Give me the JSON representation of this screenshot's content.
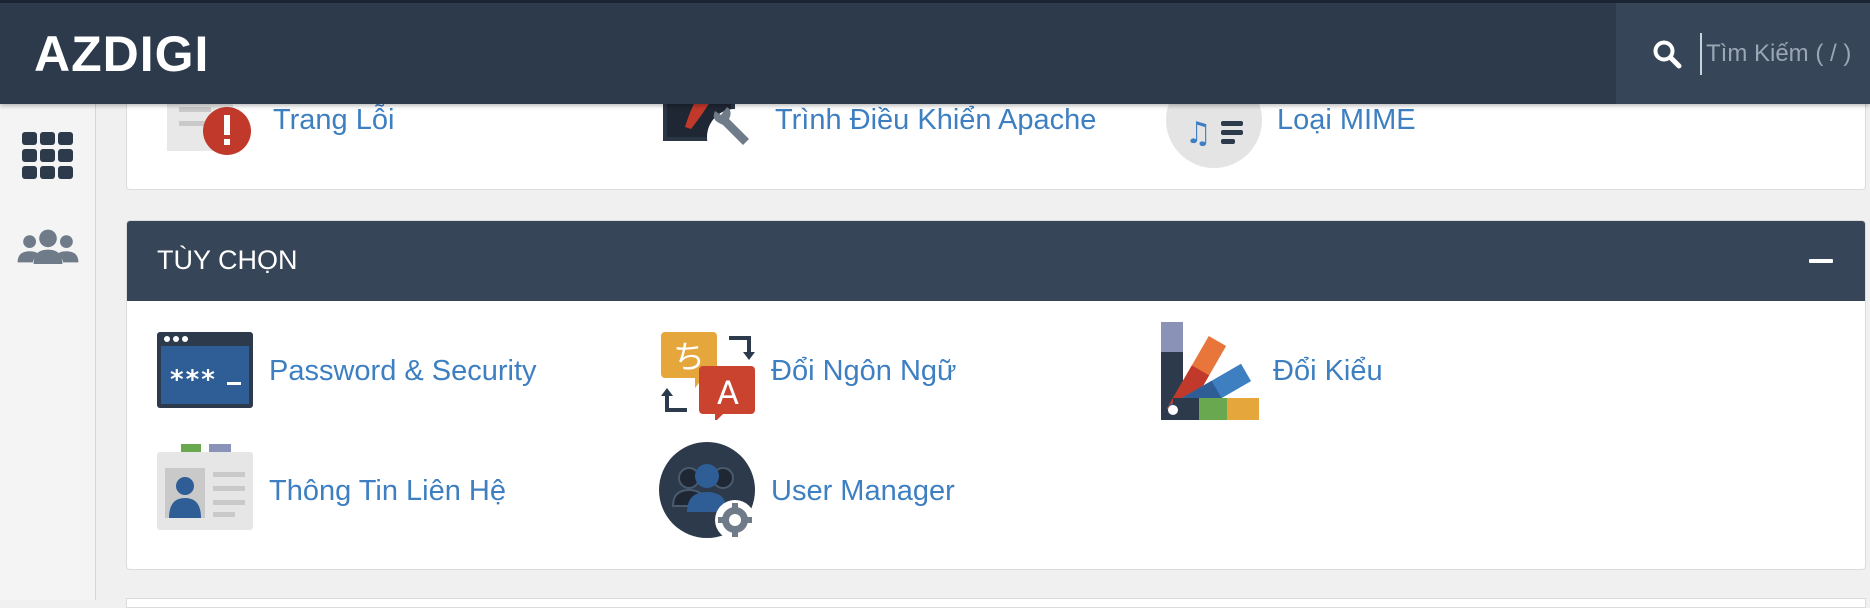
{
  "header": {
    "brand": "AZDIGI",
    "search_placeholder": "Tìm Kiếm ( / )"
  },
  "sidebar": {
    "items": [
      {
        "icon": "grid-icon"
      },
      {
        "icon": "users-group-icon"
      }
    ]
  },
  "top_section": {
    "items": [
      {
        "label": "Trang Lỗi",
        "icon": "error-page-icon"
      },
      {
        "label": "Trình Điều Khiển Apache",
        "icon": "apache-handler-icon"
      },
      {
        "label": "Loại MIME",
        "icon": "mime-types-icon"
      }
    ]
  },
  "options_section": {
    "title": "TÙY CHỌN",
    "items": [
      {
        "label": "Password & Security",
        "icon": "password-security-icon"
      },
      {
        "label": "Đổi Ngôn Ngữ",
        "icon": "change-language-icon"
      },
      {
        "label": "Đổi Kiểu",
        "icon": "change-style-icon"
      },
      {
        "label": "Thông Tin Liên Hệ",
        "icon": "contact-info-icon"
      },
      {
        "label": "User Manager",
        "icon": "user-manager-icon"
      }
    ]
  },
  "colors": {
    "header_bg": "#2c3a4c",
    "link": "#3d7fc1",
    "section_header_bg": "#364557"
  }
}
